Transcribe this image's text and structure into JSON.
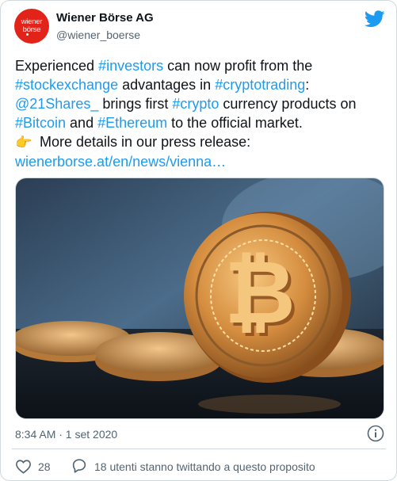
{
  "account": {
    "name": "Wiener Börse AG",
    "handle": "@wiener_boerse",
    "avatar_line1": "wiener",
    "avatar_line2": "börse",
    "avatar_color": "#e2231a"
  },
  "tweet": {
    "line1": {
      "t1": "Experienced ",
      "h1": "#investors",
      "t2": " can  now profit from the"
    },
    "line2": {
      "h1": "#stockexchange",
      "t1": " advantages in ",
      "h2": "#cryptotrading",
      "t2": ":"
    },
    "line3": {
      "m1": "@21Shares_",
      "t1": " brings first ",
      "h1": "#crypto",
      "t2": " currency products on"
    },
    "line4": {
      "h1": "#Bitcoin",
      "t1": " and ",
      "h2": "#Ethereum",
      "t2": " to the official market."
    },
    "line5": {
      "emoji": "👉",
      "t1": " More details in our press release:"
    },
    "line6": {
      "url": "wienerborse.at/en/news/vienna…"
    }
  },
  "media": {
    "icon": "bitcoin-coin-image"
  },
  "footer": {
    "timestamp": "8:34 AM · 1 set 2020",
    "likes": "28",
    "reply_label": "18 utenti stanno twittando a questo proposito"
  },
  "colors": {
    "link": "#1d9bf0",
    "muted": "#536471",
    "text": "#0f1419",
    "twitter": "#1d9bf0"
  }
}
